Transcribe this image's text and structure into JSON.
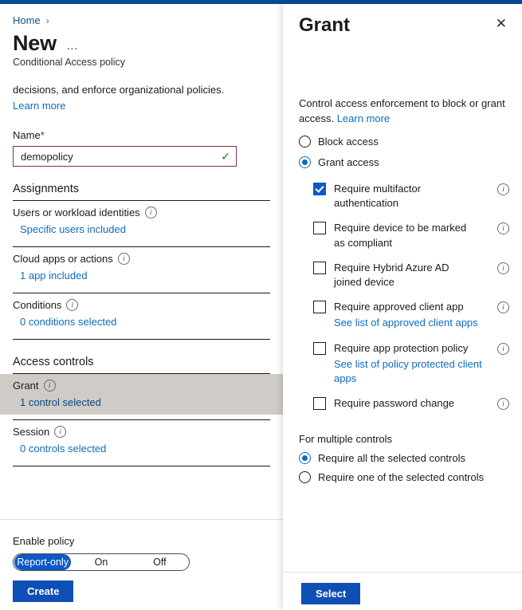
{
  "colors": {
    "accent_bar": "#0b4896",
    "link": "#0f6cbd",
    "primary_button": "#0f4fb5",
    "toggle_active": "#0f59c4",
    "highlight_row": "#cfcbc7",
    "input_border": "#7a2f63",
    "valid_check": "#107c10"
  },
  "left": {
    "breadcrumb": {
      "home_label": "Home",
      "separator_icon": "chevron-right-icon",
      "separator": "›"
    },
    "title": "New",
    "more_label": "…",
    "subtitle": "Conditional Access policy",
    "description": "decisions, and enforce organizational policies.",
    "learn_more_label": "Learn more",
    "name_field": {
      "label": "Name",
      "required_marker": "*",
      "value": "demopolicy",
      "placeholder": "",
      "valid_icon": "checkmark-icon",
      "valid_glyph": "✓"
    },
    "assignments": {
      "heading": "Assignments",
      "rows": [
        {
          "title": "Users or workload identities",
          "value": "Specific users included",
          "info_icon": "info-icon"
        },
        {
          "title": "Cloud apps or actions",
          "value": "1 app included",
          "info_icon": "info-icon"
        },
        {
          "title": "Conditions",
          "value": "0 conditions selected",
          "info_icon": "info-icon"
        }
      ]
    },
    "access_controls": {
      "heading": "Access controls",
      "rows": [
        {
          "title": "Grant",
          "value": "1 control selected",
          "info_icon": "info-icon",
          "selected": true
        },
        {
          "title": "Session",
          "value": "0 controls selected",
          "info_icon": "info-icon",
          "selected": false
        }
      ]
    },
    "footer": {
      "enable_label": "Enable policy",
      "toggle_options": [
        "Report-only",
        "On",
        "Off"
      ],
      "toggle_selected": "Report-only",
      "create_label": "Create"
    }
  },
  "panel": {
    "title": "Grant",
    "close_icon": "close-icon",
    "close_glyph": "✕",
    "description": "Control access enforcement to block or grant access.",
    "learn_more_label": "Learn more",
    "access_radios": [
      {
        "label": "Block access",
        "checked": false
      },
      {
        "label": "Grant access",
        "checked": true
      }
    ],
    "controls": [
      {
        "label": "Require multifactor authentication",
        "checked": true,
        "info_icon": "info-icon",
        "sub_link": ""
      },
      {
        "label": "Require device to be marked as compliant",
        "checked": false,
        "info_icon": "info-icon",
        "sub_link": ""
      },
      {
        "label": "Require Hybrid Azure AD joined device",
        "checked": false,
        "info_icon": "info-icon",
        "sub_link": ""
      },
      {
        "label": "Require approved client app",
        "checked": false,
        "info_icon": "info-icon",
        "sub_link": "See list of approved client apps"
      },
      {
        "label": "Require app protection policy",
        "checked": false,
        "info_icon": "info-icon",
        "sub_link": "See list of policy protected client apps"
      },
      {
        "label": "Require password change",
        "checked": false,
        "info_icon": "info-icon",
        "sub_link": ""
      }
    ],
    "multiple_controls": {
      "heading": "For multiple controls",
      "options": [
        {
          "label": "Require all the selected controls",
          "checked": true
        },
        {
          "label": "Require one of the selected controls",
          "checked": false
        }
      ]
    },
    "select_label": "Select"
  }
}
